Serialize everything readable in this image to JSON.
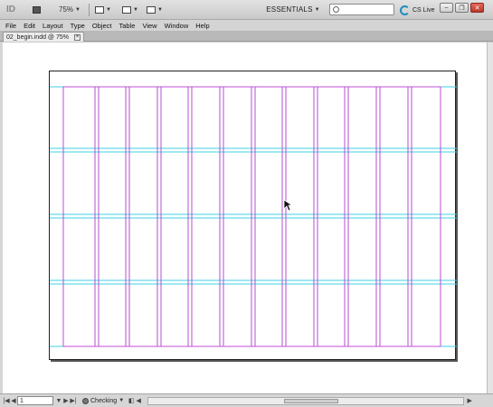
{
  "appbar": {
    "logo": "ID",
    "zoom": "75%",
    "workspace": "ESSENTIALS",
    "search_placeholder": "",
    "cs_live": "CS Live"
  },
  "menu": [
    "File",
    "Edit",
    "Layout",
    "Type",
    "Object",
    "Table",
    "View",
    "Window",
    "Help"
  ],
  "document": {
    "tab_title": "02_begin.indd @ 75%"
  },
  "status": {
    "page": "1",
    "preflight": "Checking"
  },
  "colors": {
    "column_guide": "#b44fd0",
    "row_guide": "#3fd0e6",
    "page_border": "#222222",
    "margin_guide": "#c04fd6"
  },
  "icons": [
    "indesign-logo-icon",
    "bridge-icon",
    "view-options-icon",
    "screen-mode-icon",
    "arrange-documents-icon",
    "search-icon",
    "cs-live-icon",
    "minimize-icon",
    "restore-icon",
    "close-icon",
    "pointer-cursor-icon"
  ]
}
